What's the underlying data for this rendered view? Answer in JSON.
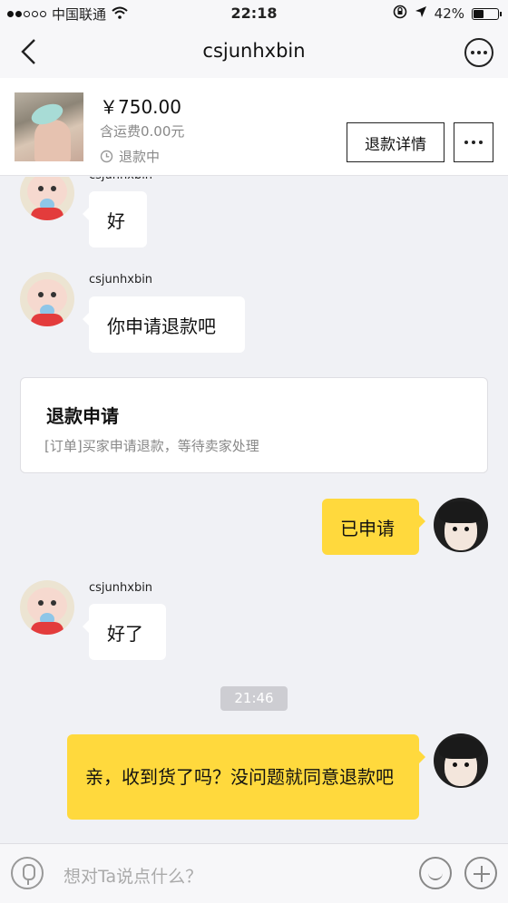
{
  "status_bar": {
    "carrier": "中国联通",
    "time": "22:18",
    "battery": "42%",
    "battery_level": 0.42
  },
  "nav": {
    "title": "csjunhxbin"
  },
  "order": {
    "price": "￥750.00",
    "shipping": "含运费0.00元",
    "status": "退款中",
    "detail_button": "退款详情"
  },
  "messages": [
    {
      "from": "seller",
      "sender": "csjunhxbin",
      "text": "好"
    },
    {
      "from": "seller",
      "sender": "csjunhxbin",
      "text": "你申请退款吧"
    },
    {
      "from": "system_card",
      "title": "退款申请",
      "desc": "[订单]买家申请退款，等待卖家处理"
    },
    {
      "from": "me",
      "text": "已申请"
    },
    {
      "from": "seller",
      "sender": "csjunhxbin",
      "text": "好了"
    },
    {
      "from": "timestamp",
      "text": "21:46"
    },
    {
      "from": "me",
      "text": "亲，收到货了吗？没问题就同意退款吧"
    }
  ],
  "input": {
    "placeholder": "想对Ta说点什么？"
  }
}
